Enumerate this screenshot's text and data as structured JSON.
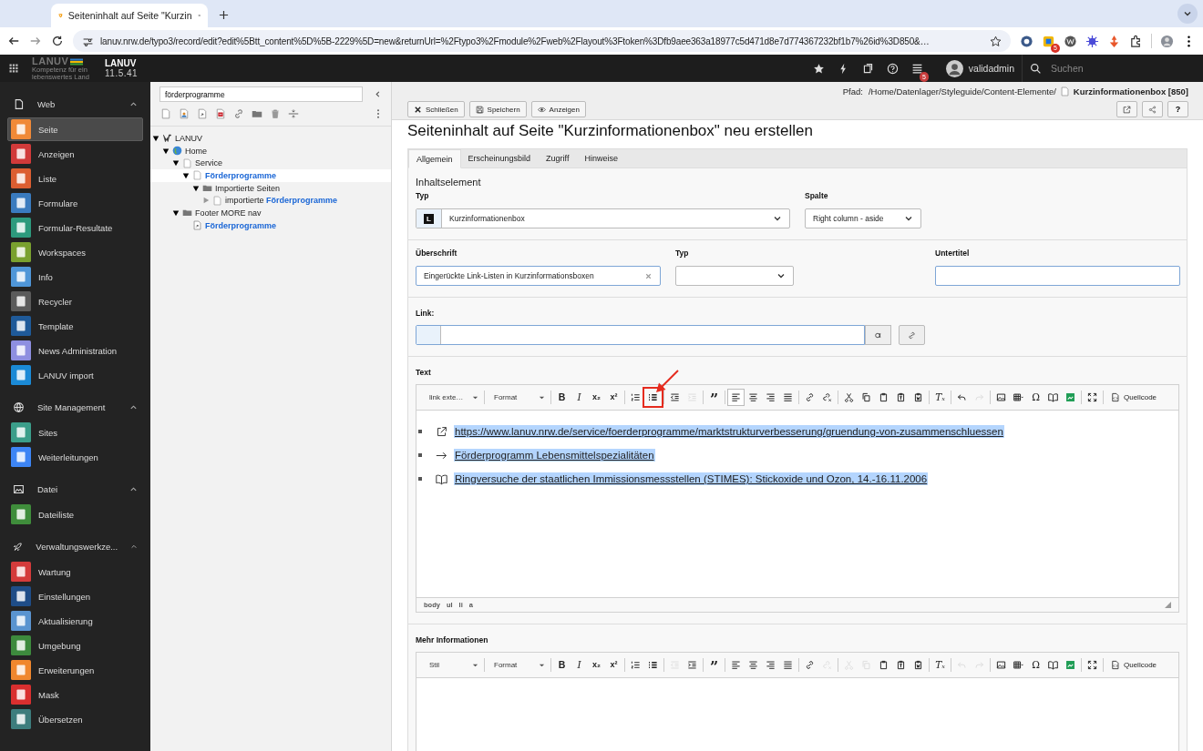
{
  "browser": {
    "tab_title": "Seiteninhalt auf Seite \"Kurzin",
    "url": "lanuv.nrw.de/typo3/record/edit?edit%5Btt_content%5D%5B-2229%5D=new&returnUrl=%2Ftypo3%2Fmodule%2Fweb%2Flayout%3Ftoken%3Dfb9aee363a18977c5d471d8e7d774367232bf1b7%26id%3D850&…",
    "extension_badge": "5"
  },
  "topbar": {
    "logo_text": "LANUV",
    "logo_tagline": "Kompetenz für ein lebenswertes Land",
    "site_name": "LANUV",
    "version": "11.5.41",
    "notification_badge": "5",
    "user": "validadmin",
    "search_placeholder": "Suchen"
  },
  "sidebar": [
    {
      "label": "Web",
      "kind": "page",
      "expanded": true,
      "items": [
        {
          "label": "Seite",
          "color": "#f08a38",
          "selected": true
        },
        {
          "label": "Anzeigen",
          "color": "#d13a3a",
          "selected": false
        },
        {
          "label": "Liste",
          "color": "#dc5e31",
          "selected": false
        },
        {
          "label": "Formulare",
          "color": "#3a7bbf",
          "selected": false
        },
        {
          "label": "Formular-Resultate",
          "color": "#2d9a7d",
          "selected": false
        },
        {
          "label": "Workspaces",
          "color": "#7aa12f",
          "selected": false
        },
        {
          "label": "Info",
          "color": "#4f96d8",
          "selected": false
        },
        {
          "label": "Recycler",
          "color": "#5b5b5b",
          "selected": false
        },
        {
          "label": "Template",
          "color": "#1f5a99",
          "selected": false
        },
        {
          "label": "News Administration",
          "color": "#8e8fe0",
          "selected": false
        },
        {
          "label": "LANUV import",
          "color": "#1b8ad6",
          "selected": false
        }
      ]
    },
    {
      "label": "Site Management",
      "kind": "globe",
      "expanded": true,
      "items": [
        {
          "label": "Sites",
          "color": "#3b9e8a",
          "selected": false
        },
        {
          "label": "Weiterleitungen",
          "color": "#3d85f5",
          "selected": false
        }
      ]
    },
    {
      "label": "Datei",
      "kind": "image",
      "expanded": true,
      "items": [
        {
          "label": "Dateiliste",
          "color": "#3f8d3b",
          "selected": false
        }
      ]
    },
    {
      "label": "Verwaltungswerkze...",
      "kind": "rocket",
      "expanded": true,
      "items": [
        {
          "label": "Wartung",
          "color": "#d43b3b",
          "selected": false
        },
        {
          "label": "Einstellungen",
          "color": "#1f4d87",
          "selected": false
        },
        {
          "label": "Aktualisierung",
          "color": "#5a94d0",
          "selected": false
        },
        {
          "label": "Umgebung",
          "color": "#3d8a3d",
          "selected": false
        },
        {
          "label": "Erweiterungen",
          "color": "#f0872e",
          "selected": false
        },
        {
          "label": "Mask",
          "color": "#d92f2f",
          "selected": false
        },
        {
          "label": "Übersetzen",
          "color": "#3d7d7d",
          "selected": false
        }
      ]
    }
  ],
  "tree": {
    "filter": "förderprogramme",
    "nodes": [
      {
        "label": "LANUV",
        "kind": "root",
        "has_children": true,
        "expanded": true,
        "selected": false,
        "match": false,
        "children": [
          {
            "label": "Home",
            "kind": "globe",
            "has_children": true,
            "expanded": true,
            "selected": false,
            "match": false,
            "children": [
              {
                "label": "Service",
                "kind": "page",
                "has_children": true,
                "expanded": true,
                "selected": false,
                "match": false,
                "children": [
                  {
                    "label": "Förderprogramme",
                    "kind": "page",
                    "has_children": true,
                    "expanded": true,
                    "selected": true,
                    "match": true,
                    "children": [
                      {
                        "label": "Importierte Seiten",
                        "kind": "folder",
                        "has_children": true,
                        "expanded": true,
                        "selected": false,
                        "match": false,
                        "children": [
                          {
                            "label": "importierte **Förderprogramme**",
                            "kind": "page",
                            "has_children": true,
                            "expanded": false,
                            "selected": false,
                            "match": false
                          }
                        ]
                      }
                    ]
                  }
                ]
              },
              {
                "label": "Footer MORE nav",
                "kind": "folder",
                "has_children": true,
                "expanded": true,
                "selected": false,
                "match": false,
                "children": [
                  {
                    "label": "Förderprogramme",
                    "kind": "shortcut",
                    "has_children": false,
                    "selected": false,
                    "match": true
                  }
                ]
              }
            ]
          }
        ]
      }
    ]
  },
  "docheader": {
    "path_label": "Pfad:",
    "path": "/Home/Datenlager/Styleguide/Content-Elemente/",
    "page": "Kurzinformationenbox [850]",
    "buttons": [
      "Schließen",
      "Speichern",
      "Anzeigen"
    ],
    "help": "?"
  },
  "title": "Seiteninhalt auf Seite \"Kurzinformationenbox\" neu erstellen",
  "tabs": [
    {
      "label": "Allgemein",
      "selected": true
    },
    {
      "label": "Erscheinungsbild",
      "selected": false
    },
    {
      "label": "Zugriff",
      "selected": false
    },
    {
      "label": "Hinweise",
      "selected": false
    }
  ],
  "form": {
    "section": "Inhaltselement",
    "type": {
      "label": "Typ",
      "icon_letter": "L",
      "value": "Kurzinformationenbox"
    },
    "column": {
      "label": "Spalte",
      "value": "Right column - aside"
    },
    "header": {
      "label": "Überschrift",
      "value": "Eingerückte Link-Listen in Kurzinformationsboxen"
    },
    "header_type": {
      "label": "Typ"
    },
    "subheader": {
      "label": "Untertitel"
    },
    "link": {
      "label": "Link:"
    },
    "text": {
      "label": "Text",
      "toolbar": [
        [
          {
            "kind": "select",
            "label": "link exte…"
          }
        ],
        [
          {
            "kind": "select",
            "label": "Format"
          }
        ],
        [
          {
            "kind": "bold",
            "glyph": "B",
            "disabled": false,
            "active": false,
            "highlighted": false
          },
          {
            "kind": "italic",
            "glyph": "I",
            "disabled": false,
            "active": false,
            "highlighted": false
          },
          {
            "kind": "subscript",
            "glyph": "x₂",
            "disabled": false,
            "active": false,
            "highlighted": false
          },
          {
            "kind": "superscript",
            "glyph": "x²",
            "disabled": false,
            "active": false,
            "highlighted": false
          }
        ],
        [
          {
            "kind": "ol",
            "disabled": false,
            "active": false,
            "highlighted": false
          },
          {
            "kind": "ul",
            "disabled": false,
            "active": false,
            "highlighted": true
          }
        ],
        [
          {
            "kind": "outdent",
            "disabled": false,
            "active": false,
            "highlighted": false
          },
          {
            "kind": "indent",
            "disabled": true,
            "active": false,
            "highlighted": false
          }
        ],
        [
          {
            "kind": "blockquote",
            "glyph": "”",
            "disabled": false,
            "active": false,
            "highlighted": false
          }
        ],
        [
          {
            "kind": "align-left",
            "disabled": false,
            "active": true,
            "highlighted": false
          },
          {
            "kind": "align-center",
            "disabled": false,
            "active": false,
            "highlighted": false
          },
          {
            "kind": "align-right",
            "disabled": false,
            "active": false,
            "highlighted": false
          },
          {
            "kind": "justify",
            "disabled": false,
            "active": false,
            "highlighted": false
          }
        ],
        [
          {
            "kind": "link",
            "disabled": false,
            "active": false,
            "highlighted": false
          },
          {
            "kind": "unlink",
            "disabled": false,
            "active": false,
            "highlighted": false
          }
        ],
        [
          {
            "kind": "cut",
            "disabled": false,
            "active": false,
            "highlighted": false
          },
          {
            "kind": "copy",
            "disabled": false,
            "active": false,
            "highlighted": false
          },
          {
            "kind": "paste",
            "disabled": false,
            "active": false,
            "highlighted": false
          },
          {
            "kind": "paste-text",
            "disabled": false,
            "active": false,
            "highlighted": false
          },
          {
            "kind": "paste-word",
            "disabled": false,
            "active": false,
            "highlighted": false
          }
        ],
        [
          {
            "kind": "remove-format",
            "glyph": "Tₓ",
            "disabled": false,
            "active": false,
            "highlighted": false
          }
        ],
        [
          {
            "kind": "undo",
            "disabled": false,
            "active": false,
            "highlighted": false
          },
          {
            "kind": "redo",
            "disabled": true,
            "active": false,
            "highlighted": false
          }
        ],
        [
          {
            "kind": "image",
            "disabled": false,
            "active": false,
            "highlighted": false
          },
          {
            "kind": "table",
            "disabled": false,
            "active": false,
            "highlighted": false
          },
          {
            "kind": "special-char",
            "glyph": "Ω",
            "disabled": false,
            "active": false,
            "highlighted": false
          },
          {
            "kind": "book",
            "disabled": false,
            "active": false,
            "highlighted": false
          },
          {
            "kind": "media",
            "disabled": false,
            "active": false,
            "highlighted": false
          }
        ],
        [
          {
            "kind": "maximize",
            "disabled": false,
            "active": false,
            "highlighted": false
          }
        ],
        [
          {
            "kind": "source",
            "label": "Quellcode"
          }
        ]
      ],
      "items": [
        {
          "kind": "external-link",
          "text": "https://www.lanuv.nrw.de/service/foerderprogramme/marktstrukturverbesserung/gruendung-von-zusammenschluessen",
          "selected": true
        },
        {
          "kind": "arrow",
          "text": "Förderprogramm Lebensmittelspezialitäten",
          "selected": true
        },
        {
          "kind": "book",
          "text": "Ringversuche der staatlichen Immissionsmessstellen (STIMES): Stickoxide und Ozon, 14.-16.11.2006",
          "selected": true
        }
      ],
      "status_path": [
        "body",
        "ul",
        "li",
        "a"
      ]
    },
    "more": {
      "label": "Mehr Informationen",
      "toolbar": [
        [
          {
            "kind": "select",
            "label": "Stil"
          }
        ],
        [
          {
            "kind": "select",
            "label": "Format"
          }
        ],
        [
          {
            "kind": "bold",
            "glyph": "B",
            "disabled": false,
            "active": false,
            "highlighted": false
          },
          {
            "kind": "italic",
            "glyph": "I",
            "disabled": false,
            "active": false,
            "highlighted": false
          },
          {
            "kind": "subscript",
            "glyph": "x₂",
            "disabled": false,
            "active": false,
            "highlighted": false
          },
          {
            "kind": "superscript",
            "glyph": "x²",
            "disabled": false,
            "active": false,
            "highlighted": false
          }
        ],
        [
          {
            "kind": "ol",
            "disabled": false,
            "active": false,
            "highlighted": false
          },
          {
            "kind": "ul",
            "disabled": false,
            "active": false,
            "highlighted": false
          }
        ],
        [
          {
            "kind": "outdent",
            "disabled": true,
            "active": false,
            "highlighted": false
          },
          {
            "kind": "indent",
            "disabled": false,
            "active": false,
            "highlighted": false
          }
        ],
        [
          {
            "kind": "blockquote",
            "glyph": "”",
            "disabled": false,
            "active": false,
            "highlighted": false
          }
        ],
        [
          {
            "kind": "align-left",
            "disabled": false,
            "active": false,
            "highlighted": false
          },
          {
            "kind": "align-center",
            "disabled": false,
            "active": false,
            "highlighted": false
          },
          {
            "kind": "align-right",
            "disabled": false,
            "active": false,
            "highlighted": false
          },
          {
            "kind": "justify",
            "disabled": false,
            "active": false,
            "highlighted": false
          }
        ],
        [
          {
            "kind": "link",
            "disabled": false,
            "active": false,
            "highlighted": false
          },
          {
            "kind": "unlink",
            "disabled": true,
            "active": false,
            "highlighted": false
          }
        ],
        [
          {
            "kind": "cut",
            "disabled": true,
            "active": false,
            "highlighted": false
          },
          {
            "kind": "copy",
            "disabled": true,
            "active": false,
            "highlighted": false
          },
          {
            "kind": "paste",
            "disabled": false,
            "active": false,
            "highlighted": false
          },
          {
            "kind": "paste-text",
            "disabled": false,
            "active": false,
            "highlighted": false
          },
          {
            "kind": "paste-word",
            "disabled": false,
            "active": false,
            "highlighted": false
          }
        ],
        [
          {
            "kind": "remove-format",
            "glyph": "Tₓ",
            "disabled": false,
            "active": false,
            "highlighted": false
          }
        ],
        [
          {
            "kind": "undo",
            "disabled": true,
            "active": false,
            "highlighted": false
          },
          {
            "kind": "redo",
            "disabled": true,
            "active": false,
            "highlighted": false
          }
        ],
        [
          {
            "kind": "image",
            "disabled": false,
            "active": false,
            "highlighted": false
          },
          {
            "kind": "table",
            "disabled": false,
            "active": false,
            "highlighted": false
          },
          {
            "kind": "special-char",
            "glyph": "Ω",
            "disabled": false,
            "active": false,
            "highlighted": false
          },
          {
            "kind": "book",
            "disabled": false,
            "active": false,
            "highlighted": false
          },
          {
            "kind": "media",
            "disabled": false,
            "active": false,
            "highlighted": false
          }
        ],
        [
          {
            "kind": "maximize",
            "disabled": false,
            "active": false,
            "highlighted": false
          }
        ],
        [
          {
            "kind": "source",
            "label": "Quellcode"
          }
        ]
      ]
    }
  }
}
